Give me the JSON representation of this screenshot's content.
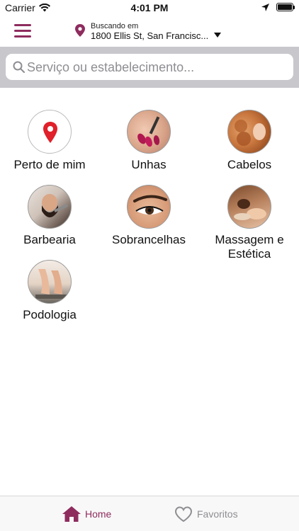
{
  "status_bar": {
    "carrier": "Carrier",
    "time": "4:01 PM"
  },
  "header": {
    "location_caption": "Buscando em",
    "location_address": "1800 Ellis St, San Francisc..."
  },
  "search": {
    "placeholder": "Serviço ou estabelecimento..."
  },
  "categories": [
    {
      "label": "Perto de mim",
      "icon": "location-pin-icon"
    },
    {
      "label": "Unhas",
      "icon": "nails-photo"
    },
    {
      "label": "Cabelos",
      "icon": "hair-photo"
    },
    {
      "label": "Barbearia",
      "icon": "barber-photo"
    },
    {
      "label": "Sobrancelhas",
      "icon": "eyebrow-photo"
    },
    {
      "label": "Massagem e Estética",
      "icon": "massage-photo"
    },
    {
      "label": "Podologia",
      "icon": "feet-photo"
    }
  ],
  "tab_bar": {
    "home_label": "Home",
    "favorites_label": "Favoritos"
  },
  "colors": {
    "brand": "#8e2c5e",
    "pin_red": "#e0202a",
    "inactive": "#8e8e93"
  }
}
